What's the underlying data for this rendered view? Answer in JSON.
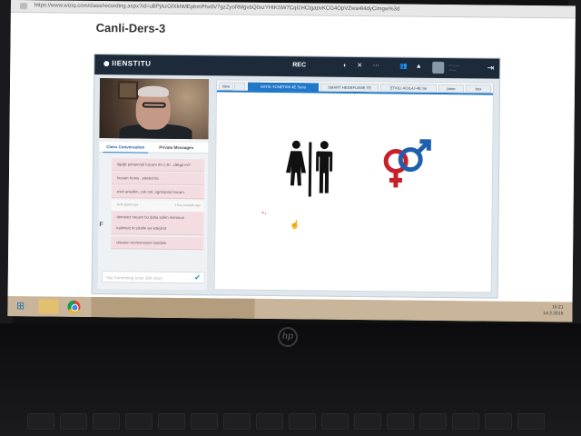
{
  "browser": {
    "url": "https://www.wiziq.com/class/recording.aspx?id=uBPjAzGfXkhMEpbmPhx0V7gzZyoRMgvbQ0xzYHtKSW7CqI1HCtgapvKCG4OpVZwsi4l4dyCimgw%3d"
  },
  "page": {
    "title": "Canli-Ders-3"
  },
  "app": {
    "brand": "IIENSTITU",
    "rec_label": "REC"
  },
  "chat": {
    "tabs": [
      "Class Conversation",
      "Private Messages"
    ],
    "messages": [
      {
        "text": "ilgaljk pmtamnpl hocam 90 x 30 ..dilegil mi?"
      },
      {
        "text": "hocam Kenw ..ettelerrinc"
      },
      {
        "text": "evet anladim, cok net, ogrenjemi hocam."
      },
      {
        "meta": "Gelk Qaldi says",
        "time": "2 few seconds ago"
      },
      {
        "text": "demelez hocam bu daha sülen memnun"
      },
      {
        "text": "kalimiyiz ki sizelle ws isteyiniz"
      },
      {
        "text": "olsuyen memonsoyel rsaldulu"
      }
    ],
    "sender_initial": "F",
    "input_placeholder": "Say Something (max 380 char)"
  },
  "whiteboard": {
    "tabs": [
      {
        "label": "New",
        "active": false
      },
      {
        "label": "SATIS YONETIMI 4E Sunu",
        "active": true
      },
      {
        "label": "SMART HEDEFLEME TE",
        "active": false
      },
      {
        "label": "ETKILI AOIL4J-4E Se",
        "active": false
      },
      {
        "label": "pane",
        "active": false
      },
      {
        "label": "box",
        "active": false
      }
    ],
    "icons": [
      "restroom-icon",
      "gender-symbol-icon"
    ],
    "colors": {
      "female": "#c8202b",
      "male": "#1f5fb0",
      "pictogram": "#111111"
    }
  },
  "taskbar": {
    "clock_time": "15:21",
    "clock_date": "14.2.2015"
  },
  "colors": {
    "topbar": "#1c2a3a",
    "accent": "#1f78c8",
    "taskbar": "#c9b69a"
  }
}
